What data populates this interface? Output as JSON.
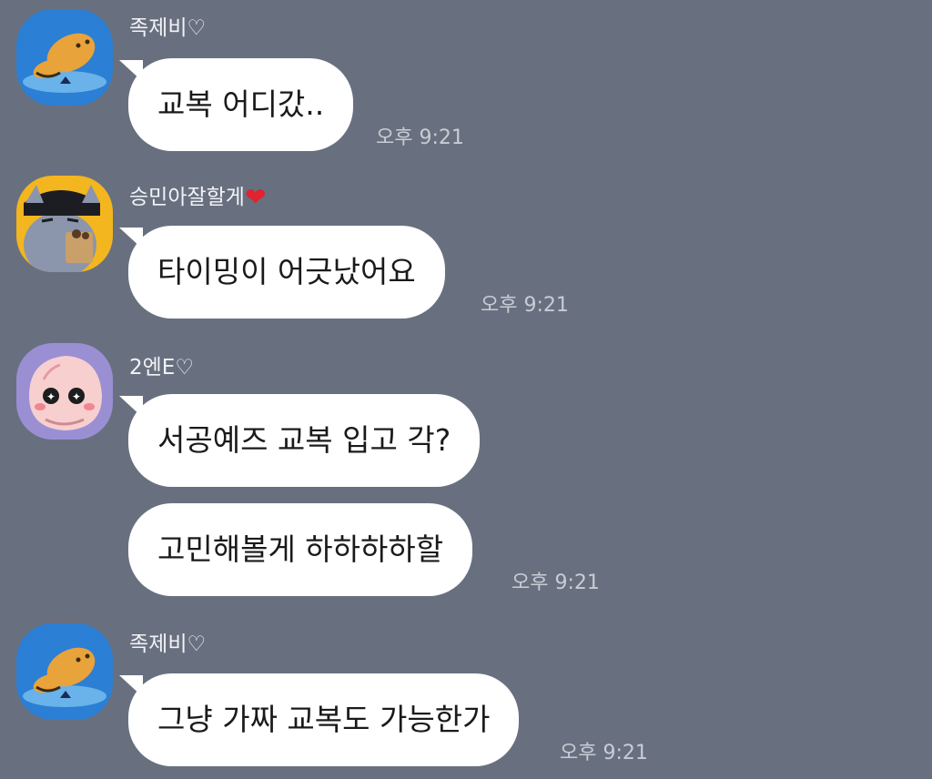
{
  "chat": {
    "messages": [
      {
        "sender": "족제비♡",
        "avatar": "ryan-character-avatar",
        "bubbles": [
          "교복 어디갔.."
        ],
        "time": "오후 9:21"
      },
      {
        "sender": "승민아잘할게",
        "sender_suffix": "❤",
        "avatar": "cat-character-avatar",
        "bubbles": [
          "타이밍이 어긋났어요"
        ],
        "time": "오후 9:21"
      },
      {
        "sender": "2엔E♡",
        "avatar": "apeach-character-avatar",
        "bubbles": [
          "서공예즈 교복 입고 각?",
          "고민해볼게 하하하하할"
        ],
        "time": "오후 9:21"
      },
      {
        "sender": "족제비♡",
        "avatar": "ryan-character-avatar",
        "bubbles": [
          "그냥 가짜 교복도 가능한가"
        ],
        "time": "오후 9:21"
      }
    ]
  },
  "colors": {
    "background": "#687080",
    "bubble": "#ffffff",
    "heart": "#e0232f"
  }
}
